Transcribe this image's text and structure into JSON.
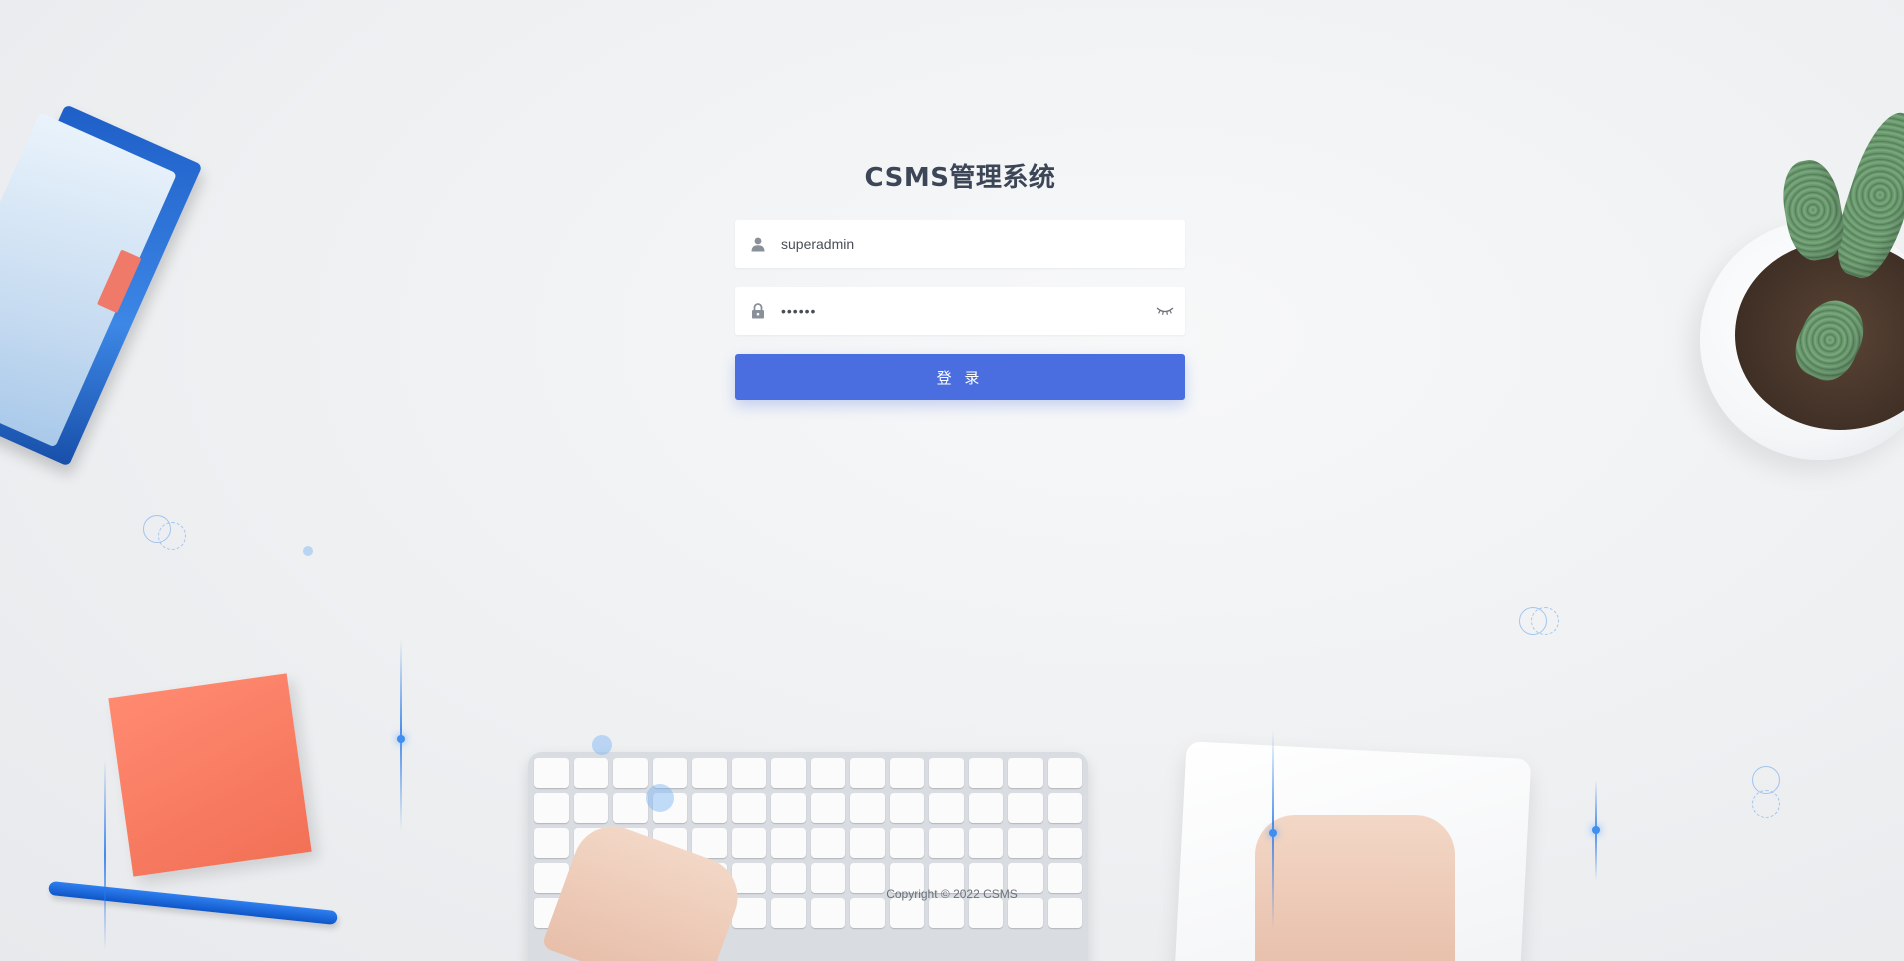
{
  "app": {
    "title": "CSMS管理系统"
  },
  "login": {
    "username_value": "superadmin",
    "username_placeholder": "",
    "password_value": "••••••",
    "submit_label": "登 录"
  },
  "footer": {
    "copyright": "Copyright © 2022 CSMS"
  },
  "icons": {
    "username": "user-icon",
    "password": "lock-icon",
    "toggle": "eye-closed-icon"
  },
  "colors": {
    "primary": "#4a6ee0",
    "title": "#3c4657",
    "background": "#eef0f2"
  }
}
